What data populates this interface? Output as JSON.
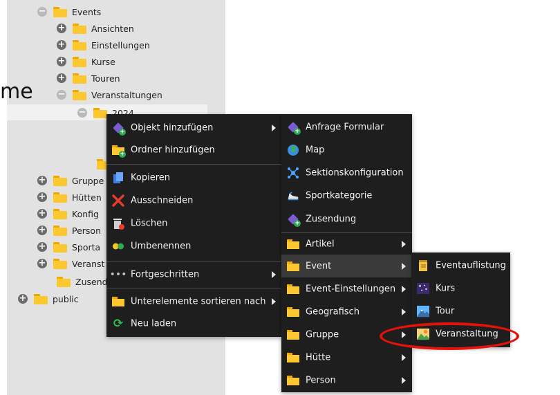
{
  "background_title": "me",
  "tree": [
    {
      "label": "Events",
      "expander": "minus"
    },
    {
      "label": "Ansichten",
      "expander": "plus"
    },
    {
      "label": "Einstellungen",
      "expander": "plus"
    },
    {
      "label": "Kurse",
      "expander": "plus"
    },
    {
      "label": "Touren",
      "expander": "plus"
    },
    {
      "label": "Veranstaltungen",
      "expander": "minus"
    },
    {
      "label": "2024",
      "expander": "minus"
    },
    {
      "label": "",
      "expander": "none"
    },
    {
      "label": "Gruppe",
      "expander": "plus"
    },
    {
      "label": "Hütten",
      "expander": "plus"
    },
    {
      "label": "Konfig",
      "expander": "plus"
    },
    {
      "label": "Person",
      "expander": "plus"
    },
    {
      "label": "Sporta",
      "expander": "plus"
    },
    {
      "label": "Veranst",
      "expander": "plus"
    },
    {
      "label": "Zusend",
      "expander": "none"
    },
    {
      "label": "public",
      "expander": "plus"
    }
  ],
  "context_menu": {
    "items": [
      {
        "label": "Objekt hinzufügen",
        "icon": "cube-plus-icon",
        "submenu": true
      },
      {
        "label": "Ordner hinzufügen",
        "icon": "folder-plus-icon",
        "submenu": false
      },
      {
        "label": "Kopieren",
        "icon": "copy-icon",
        "submenu": false
      },
      {
        "label": "Ausschneiden",
        "icon": "scissors-icon",
        "submenu": false
      },
      {
        "label": "Löschen",
        "icon": "trash-icon",
        "submenu": false
      },
      {
        "label": "Umbenennen",
        "icon": "rename-icon",
        "submenu": false
      },
      {
        "label": "Fortgeschritten",
        "icon": "ellipsis-icon",
        "submenu": true
      },
      {
        "label": "Unterelemente sortieren nach",
        "icon": "folder-icon",
        "submenu": true
      },
      {
        "label": "Neu laden",
        "icon": "reload-icon",
        "submenu": false
      }
    ]
  },
  "object_submenu": {
    "items": [
      {
        "label": "Anfrage Formular",
        "icon": "cube-plus-icon",
        "submenu": false
      },
      {
        "label": "Map",
        "icon": "globe-icon",
        "submenu": false
      },
      {
        "label": "Sektionskonfiguration",
        "icon": "network-icon",
        "submenu": false
      },
      {
        "label": "Sportkategorie",
        "icon": "shoe-icon",
        "submenu": false
      },
      {
        "label": "Zusendung",
        "icon": "cube-plus-icon",
        "submenu": false
      },
      {
        "label": "Artikel",
        "icon": "folder-icon",
        "submenu": true
      },
      {
        "label": "Event",
        "icon": "folder-icon",
        "submenu": true
      },
      {
        "label": "Event-Einstellungen",
        "icon": "folder-icon",
        "submenu": true
      },
      {
        "label": "Geografisch",
        "icon": "folder-icon",
        "submenu": true
      },
      {
        "label": "Gruppe",
        "icon": "folder-icon",
        "submenu": true
      },
      {
        "label": "Hütte",
        "icon": "folder-icon",
        "submenu": true
      },
      {
        "label": "Person",
        "icon": "folder-icon",
        "submenu": true
      }
    ]
  },
  "event_submenu": {
    "items": [
      {
        "label": "Eventauflistung",
        "icon": "scroll-icon"
      },
      {
        "label": "Kurs",
        "icon": "stars-icon"
      },
      {
        "label": "Tour",
        "icon": "mountain-icon"
      },
      {
        "label": "Veranstaltung",
        "icon": "landscape-icon"
      }
    ]
  },
  "colors": {
    "menu_bg": "#1e1e1e",
    "highlight": "#3a3a3a",
    "folder": "#fdc72f",
    "callout": "#e3120b"
  }
}
